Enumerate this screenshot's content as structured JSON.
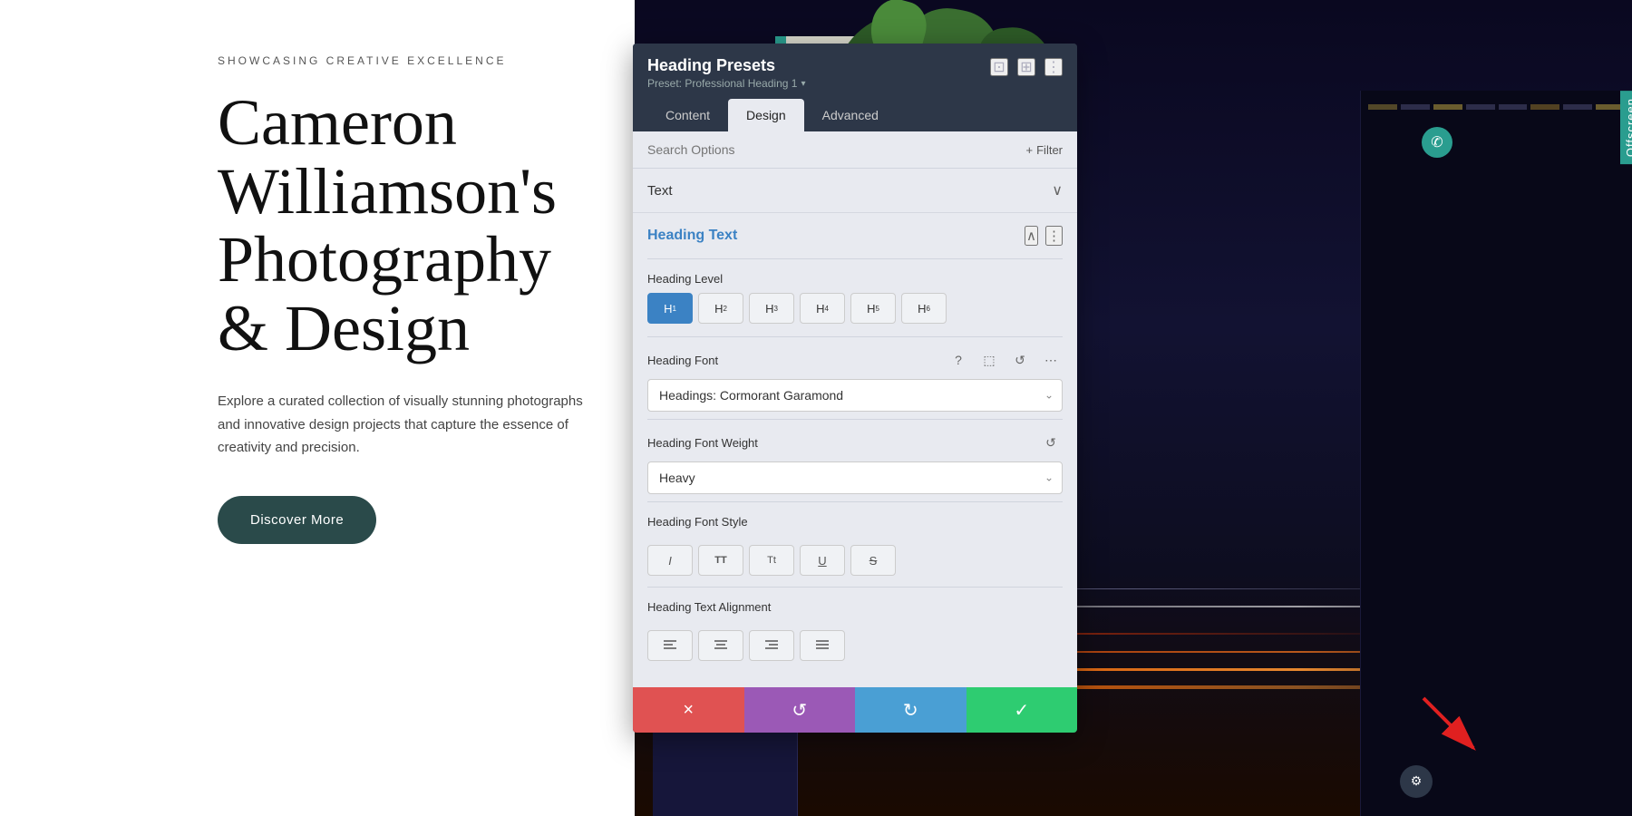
{
  "page": {
    "bg_left": "#ffffff",
    "bg_right_dark": "#0a0a2e"
  },
  "left_content": {
    "tagline": "SHOWCASING CREATIVE EXCELLENCE",
    "main_title": "Cameron Williamson's Photography & Design",
    "subtitle": "Explore a curated collection of visually stunning photographs and innovative design projects that capture the essence of creativity and precision.",
    "cta_label": "Discover More"
  },
  "offscreen_label": "Offscreen",
  "panel": {
    "title": "Heading Presets",
    "subtitle": "Preset: Professional Heading 1",
    "tabs": [
      "Content",
      "Design",
      "Advanced"
    ],
    "active_tab": "Design",
    "search_placeholder": "Search Options",
    "filter_label": "Filter",
    "sections": {
      "text_section": {
        "label": "Text",
        "collapsed": true
      },
      "heading_section": {
        "label": "Heading Text",
        "expanded": true,
        "heading_level_label": "Heading Level",
        "levels": [
          "H1",
          "H2",
          "H3",
          "H4",
          "H5",
          "H6"
        ],
        "active_level": "H1",
        "heading_font_label": "Heading Font",
        "font_value": "Headings: Cormorant Garamond",
        "heading_font_weight_label": "Heading Font Weight",
        "font_weight_value": "Heavy",
        "heading_font_style_label": "Heading Font Style",
        "styles": [
          "I",
          "TT",
          "Tt",
          "U",
          "S"
        ],
        "heading_text_align_label": "Heading Text Alignment"
      }
    },
    "footer_buttons": {
      "cancel_icon": "×",
      "undo_icon": "↺",
      "redo_icon": "↻",
      "confirm_icon": "✓"
    }
  },
  "icons": {
    "expand": "⊡",
    "layout": "⊞",
    "more": "⋮",
    "question": "?",
    "mobile": "📱",
    "reset": "↺",
    "dots": "⋯",
    "chevron_down": "∨",
    "chevron_up": "∧",
    "plus": "+",
    "left_align": "≡",
    "center_align": "≡",
    "right_align": "≡",
    "justify_align": "≡",
    "phone": "✆",
    "settings": "⚙"
  }
}
